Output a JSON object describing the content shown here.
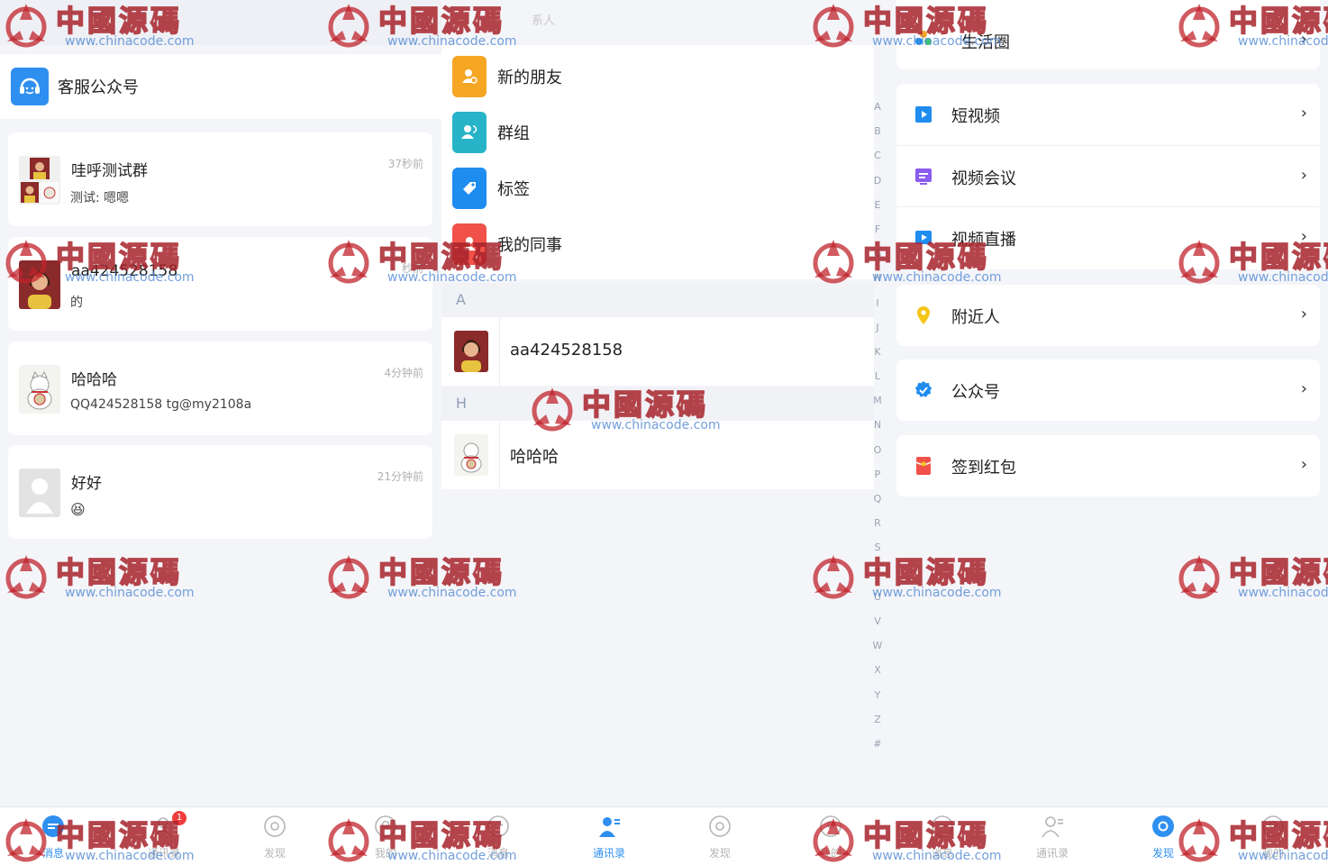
{
  "messages_panel": {
    "service_account_label": "客服公众号",
    "chats": [
      {
        "name": "哇呼测试群",
        "preview": "测试: 嗯嗯",
        "time": "37秒前"
      },
      {
        "name": "aa424528158",
        "preview": "的",
        "time": "秒前"
      },
      {
        "name": "哈哈哈",
        "preview": "QQ424528158 tg@my2108a",
        "time": "4分钟前"
      },
      {
        "name": "好好",
        "preview": "😆",
        "time": "21分钟前"
      }
    ]
  },
  "contacts_panel": {
    "search_hint": "系人",
    "entries": [
      {
        "label": "新的朋友",
        "color": "#f5a623",
        "icon": "new-friend-icon"
      },
      {
        "label": "群组",
        "color": "#27b4c8",
        "icon": "group-icon"
      },
      {
        "label": "标签",
        "color": "#1f8cf0",
        "icon": "tag-icon"
      },
      {
        "label": "我的同事",
        "color": "#f0524a",
        "icon": "colleague-icon"
      }
    ],
    "sections": [
      {
        "letter": "A",
        "contact": "aa424528158"
      },
      {
        "letter": "H",
        "contact": "哈哈哈"
      }
    ],
    "alphabet": [
      "A",
      "B",
      "C",
      "D",
      "E",
      "F",
      "G",
      "H",
      "I",
      "J",
      "K",
      "L",
      "M",
      "N",
      "O",
      "P",
      "Q",
      "R",
      "S",
      "T",
      "U",
      "V",
      "W",
      "X",
      "Y",
      "Z",
      "#"
    ]
  },
  "discover_panel": {
    "top_item": "生活圈",
    "group1": [
      {
        "label": "短视频",
        "color": "#1f8cf0",
        "icon": "play-icon"
      },
      {
        "label": "视频会议",
        "color": "#8a5cf0",
        "icon": "meeting-icon"
      },
      {
        "label": "视频直播",
        "color": "#1f8cf0",
        "icon": "live-icon"
      }
    ],
    "items": [
      {
        "label": "附近人",
        "color": "#f5c518",
        "icon": "location-pin-icon"
      },
      {
        "label": "公众号",
        "color": "#1f8cf0",
        "icon": "verified-icon"
      },
      {
        "label": "签到红包",
        "color": "#f0524a",
        "icon": "red-packet-icon"
      }
    ],
    "chevron": "›"
  },
  "tabbars": [
    {
      "tabs": [
        {
          "label": "消息",
          "active": true
        },
        {
          "label": "通讯录",
          "badge": "1"
        },
        {
          "label": "发现"
        },
        {
          "label": "我的"
        }
      ]
    },
    {
      "tabs": [
        {
          "label": "消息"
        },
        {
          "label": "通讯录",
          "active": true
        },
        {
          "label": "发现"
        },
        {
          "label": "我的"
        }
      ]
    },
    {
      "tabs": [
        {
          "label": "消息"
        },
        {
          "label": "通讯录"
        },
        {
          "label": "发现",
          "active": true
        },
        {
          "label": "我的"
        }
      ]
    }
  ],
  "watermark": {
    "cn": "中國源碼",
    "url": "www.chinacode.com"
  },
  "colors": {
    "accent": "#2f8ff0",
    "badge": "#f03d3d",
    "watermark_red": "#c0242c"
  }
}
